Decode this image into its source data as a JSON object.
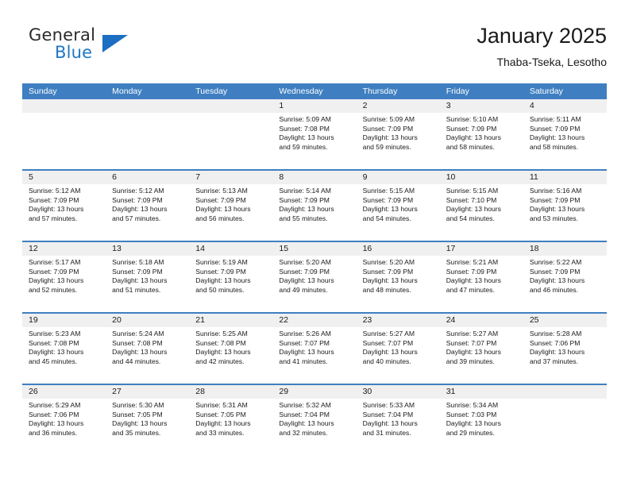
{
  "brand": {
    "name_part1": "General",
    "name_part2": "Blue",
    "logo_icon": "triangle-logo-icon"
  },
  "header": {
    "title": "January 2025",
    "subtitle": "Thaba-Tseka, Lesotho"
  },
  "colors": {
    "header_blue": "#3f7fc1",
    "brand_blue": "#2077c4",
    "day_band_gray": "#f0f0f0",
    "text": "#1a1a1a"
  },
  "weekday_headers": [
    "Sunday",
    "Monday",
    "Tuesday",
    "Wednesday",
    "Thursday",
    "Friday",
    "Saturday"
  ],
  "weeks": [
    [
      {
        "day": "",
        "empty": true,
        "sunrise": "",
        "sunset": "",
        "daylight_line1": "",
        "daylight_line2": ""
      },
      {
        "day": "",
        "empty": true,
        "sunrise": "",
        "sunset": "",
        "daylight_line1": "",
        "daylight_line2": ""
      },
      {
        "day": "",
        "empty": true,
        "sunrise": "",
        "sunset": "",
        "daylight_line1": "",
        "daylight_line2": ""
      },
      {
        "day": "1",
        "empty": false,
        "sunrise": "Sunrise: 5:09 AM",
        "sunset": "Sunset: 7:08 PM",
        "daylight_line1": "Daylight: 13 hours",
        "daylight_line2": "and 59 minutes."
      },
      {
        "day": "2",
        "empty": false,
        "sunrise": "Sunrise: 5:09 AM",
        "sunset": "Sunset: 7:09 PM",
        "daylight_line1": "Daylight: 13 hours",
        "daylight_line2": "and 59 minutes."
      },
      {
        "day": "3",
        "empty": false,
        "sunrise": "Sunrise: 5:10 AM",
        "sunset": "Sunset: 7:09 PM",
        "daylight_line1": "Daylight: 13 hours",
        "daylight_line2": "and 58 minutes."
      },
      {
        "day": "4",
        "empty": false,
        "sunrise": "Sunrise: 5:11 AM",
        "sunset": "Sunset: 7:09 PM",
        "daylight_line1": "Daylight: 13 hours",
        "daylight_line2": "and 58 minutes."
      }
    ],
    [
      {
        "day": "5",
        "empty": false,
        "sunrise": "Sunrise: 5:12 AM",
        "sunset": "Sunset: 7:09 PM",
        "daylight_line1": "Daylight: 13 hours",
        "daylight_line2": "and 57 minutes."
      },
      {
        "day": "6",
        "empty": false,
        "sunrise": "Sunrise: 5:12 AM",
        "sunset": "Sunset: 7:09 PM",
        "daylight_line1": "Daylight: 13 hours",
        "daylight_line2": "and 57 minutes."
      },
      {
        "day": "7",
        "empty": false,
        "sunrise": "Sunrise: 5:13 AM",
        "sunset": "Sunset: 7:09 PM",
        "daylight_line1": "Daylight: 13 hours",
        "daylight_line2": "and 56 minutes."
      },
      {
        "day": "8",
        "empty": false,
        "sunrise": "Sunrise: 5:14 AM",
        "sunset": "Sunset: 7:09 PM",
        "daylight_line1": "Daylight: 13 hours",
        "daylight_line2": "and 55 minutes."
      },
      {
        "day": "9",
        "empty": false,
        "sunrise": "Sunrise: 5:15 AM",
        "sunset": "Sunset: 7:09 PM",
        "daylight_line1": "Daylight: 13 hours",
        "daylight_line2": "and 54 minutes."
      },
      {
        "day": "10",
        "empty": false,
        "sunrise": "Sunrise: 5:15 AM",
        "sunset": "Sunset: 7:10 PM",
        "daylight_line1": "Daylight: 13 hours",
        "daylight_line2": "and 54 minutes."
      },
      {
        "day": "11",
        "empty": false,
        "sunrise": "Sunrise: 5:16 AM",
        "sunset": "Sunset: 7:09 PM",
        "daylight_line1": "Daylight: 13 hours",
        "daylight_line2": "and 53 minutes."
      }
    ],
    [
      {
        "day": "12",
        "empty": false,
        "sunrise": "Sunrise: 5:17 AM",
        "sunset": "Sunset: 7:09 PM",
        "daylight_line1": "Daylight: 13 hours",
        "daylight_line2": "and 52 minutes."
      },
      {
        "day": "13",
        "empty": false,
        "sunrise": "Sunrise: 5:18 AM",
        "sunset": "Sunset: 7:09 PM",
        "daylight_line1": "Daylight: 13 hours",
        "daylight_line2": "and 51 minutes."
      },
      {
        "day": "14",
        "empty": false,
        "sunrise": "Sunrise: 5:19 AM",
        "sunset": "Sunset: 7:09 PM",
        "daylight_line1": "Daylight: 13 hours",
        "daylight_line2": "and 50 minutes."
      },
      {
        "day": "15",
        "empty": false,
        "sunrise": "Sunrise: 5:20 AM",
        "sunset": "Sunset: 7:09 PM",
        "daylight_line1": "Daylight: 13 hours",
        "daylight_line2": "and 49 minutes."
      },
      {
        "day": "16",
        "empty": false,
        "sunrise": "Sunrise: 5:20 AM",
        "sunset": "Sunset: 7:09 PM",
        "daylight_line1": "Daylight: 13 hours",
        "daylight_line2": "and 48 minutes."
      },
      {
        "day": "17",
        "empty": false,
        "sunrise": "Sunrise: 5:21 AM",
        "sunset": "Sunset: 7:09 PM",
        "daylight_line1": "Daylight: 13 hours",
        "daylight_line2": "and 47 minutes."
      },
      {
        "day": "18",
        "empty": false,
        "sunrise": "Sunrise: 5:22 AM",
        "sunset": "Sunset: 7:09 PM",
        "daylight_line1": "Daylight: 13 hours",
        "daylight_line2": "and 46 minutes."
      }
    ],
    [
      {
        "day": "19",
        "empty": false,
        "sunrise": "Sunrise: 5:23 AM",
        "sunset": "Sunset: 7:08 PM",
        "daylight_line1": "Daylight: 13 hours",
        "daylight_line2": "and 45 minutes."
      },
      {
        "day": "20",
        "empty": false,
        "sunrise": "Sunrise: 5:24 AM",
        "sunset": "Sunset: 7:08 PM",
        "daylight_line1": "Daylight: 13 hours",
        "daylight_line2": "and 44 minutes."
      },
      {
        "day": "21",
        "empty": false,
        "sunrise": "Sunrise: 5:25 AM",
        "sunset": "Sunset: 7:08 PM",
        "daylight_line1": "Daylight: 13 hours",
        "daylight_line2": "and 42 minutes."
      },
      {
        "day": "22",
        "empty": false,
        "sunrise": "Sunrise: 5:26 AM",
        "sunset": "Sunset: 7:07 PM",
        "daylight_line1": "Daylight: 13 hours",
        "daylight_line2": "and 41 minutes."
      },
      {
        "day": "23",
        "empty": false,
        "sunrise": "Sunrise: 5:27 AM",
        "sunset": "Sunset: 7:07 PM",
        "daylight_line1": "Daylight: 13 hours",
        "daylight_line2": "and 40 minutes."
      },
      {
        "day": "24",
        "empty": false,
        "sunrise": "Sunrise: 5:27 AM",
        "sunset": "Sunset: 7:07 PM",
        "daylight_line1": "Daylight: 13 hours",
        "daylight_line2": "and 39 minutes."
      },
      {
        "day": "25",
        "empty": false,
        "sunrise": "Sunrise: 5:28 AM",
        "sunset": "Sunset: 7:06 PM",
        "daylight_line1": "Daylight: 13 hours",
        "daylight_line2": "and 37 minutes."
      }
    ],
    [
      {
        "day": "26",
        "empty": false,
        "sunrise": "Sunrise: 5:29 AM",
        "sunset": "Sunset: 7:06 PM",
        "daylight_line1": "Daylight: 13 hours",
        "daylight_line2": "and 36 minutes."
      },
      {
        "day": "27",
        "empty": false,
        "sunrise": "Sunrise: 5:30 AM",
        "sunset": "Sunset: 7:05 PM",
        "daylight_line1": "Daylight: 13 hours",
        "daylight_line2": "and 35 minutes."
      },
      {
        "day": "28",
        "empty": false,
        "sunrise": "Sunrise: 5:31 AM",
        "sunset": "Sunset: 7:05 PM",
        "daylight_line1": "Daylight: 13 hours",
        "daylight_line2": "and 33 minutes."
      },
      {
        "day": "29",
        "empty": false,
        "sunrise": "Sunrise: 5:32 AM",
        "sunset": "Sunset: 7:04 PM",
        "daylight_line1": "Daylight: 13 hours",
        "daylight_line2": "and 32 minutes."
      },
      {
        "day": "30",
        "empty": false,
        "sunrise": "Sunrise: 5:33 AM",
        "sunset": "Sunset: 7:04 PM",
        "daylight_line1": "Daylight: 13 hours",
        "daylight_line2": "and 31 minutes."
      },
      {
        "day": "31",
        "empty": false,
        "sunrise": "Sunrise: 5:34 AM",
        "sunset": "Sunset: 7:03 PM",
        "daylight_line1": "Daylight: 13 hours",
        "daylight_line2": "and 29 minutes."
      },
      {
        "day": "",
        "empty": true,
        "sunrise": "",
        "sunset": "",
        "daylight_line1": "",
        "daylight_line2": ""
      }
    ]
  ]
}
